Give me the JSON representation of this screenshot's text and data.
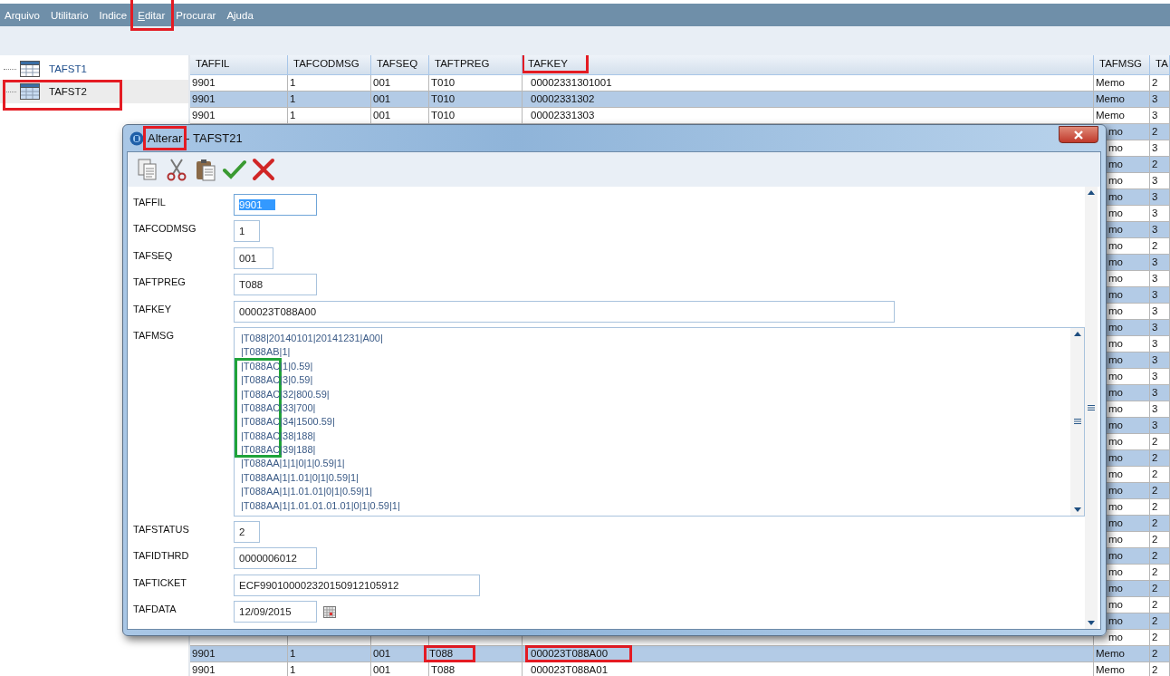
{
  "menu": [
    {
      "label": "Arquivo",
      "highlighted": false
    },
    {
      "label": "Utilitario",
      "highlighted": false
    },
    {
      "label": "Indice",
      "highlighted": false
    },
    {
      "label": "Editar",
      "highlighted": true
    },
    {
      "label": "Procurar",
      "highlighted": false
    },
    {
      "label": "Ajuda",
      "highlighted": false
    }
  ],
  "tree": [
    {
      "label": "TAFST1",
      "selected": false,
      "highlighted": false
    },
    {
      "label": "TAFST2",
      "selected": true,
      "highlighted": true
    }
  ],
  "grid": {
    "columns": [
      {
        "label": "TAFFIL",
        "highlighted": false
      },
      {
        "label": "TAFCODMSG",
        "highlighted": false
      },
      {
        "label": "TAFSEQ",
        "highlighted": false
      },
      {
        "label": "TAFTPREG",
        "highlighted": false
      },
      {
        "label": "TAFKEY",
        "highlighted": true
      },
      {
        "label": "TAFMSG",
        "highlighted": false
      },
      {
        "label": "TA",
        "highlighted": false
      }
    ],
    "rows": [
      {
        "cells": [
          "9901",
          "1",
          "001",
          "T010",
          "00002331301001",
          "Memo",
          "2"
        ]
      },
      {
        "cells": [
          "9901",
          "1",
          "001",
          "T010",
          "00002331302",
          "Memo",
          "3"
        ]
      },
      {
        "cells": [
          "9901",
          "1",
          "001",
          "T010",
          "00002331303",
          "Memo",
          "3"
        ]
      },
      {
        "under_dialog": true,
        "cells": [
          "mo",
          "2"
        ]
      },
      {
        "under_dialog": true,
        "cells": [
          "mo",
          "3"
        ]
      },
      {
        "under_dialog": true,
        "cells": [
          "mo",
          "2"
        ]
      },
      {
        "under_dialog": true,
        "cells": [
          "mo",
          "3"
        ]
      },
      {
        "under_dialog": true,
        "cells": [
          "mo",
          "3"
        ]
      },
      {
        "under_dialog": true,
        "cells": [
          "mo",
          "3"
        ]
      },
      {
        "under_dialog": true,
        "cells": [
          "mo",
          "3"
        ]
      },
      {
        "under_dialog": true,
        "cells": [
          "mo",
          "2"
        ]
      },
      {
        "under_dialog": true,
        "cells": [
          "mo",
          "3"
        ]
      },
      {
        "under_dialog": true,
        "cells": [
          "mo",
          "3"
        ]
      },
      {
        "under_dialog": true,
        "cells": [
          "mo",
          "3"
        ]
      },
      {
        "under_dialog": true,
        "cells": [
          "mo",
          "3"
        ]
      },
      {
        "under_dialog": true,
        "cells": [
          "mo",
          "3"
        ]
      },
      {
        "under_dialog": true,
        "cells": [
          "mo",
          "3"
        ]
      },
      {
        "under_dialog": true,
        "cells": [
          "mo",
          "3"
        ]
      },
      {
        "under_dialog": true,
        "cells": [
          "mo",
          "3"
        ]
      },
      {
        "under_dialog": true,
        "cells": [
          "mo",
          "3"
        ]
      },
      {
        "under_dialog": true,
        "cells": [
          "mo",
          "3"
        ]
      },
      {
        "under_dialog": true,
        "cells": [
          "mo",
          "3"
        ]
      },
      {
        "under_dialog": true,
        "cells": [
          "mo",
          "2"
        ]
      },
      {
        "under_dialog": true,
        "cells": [
          "mo",
          "2"
        ]
      },
      {
        "under_dialog": true,
        "cells": [
          "mo",
          "2"
        ]
      },
      {
        "under_dialog": true,
        "cells": [
          "mo",
          "2"
        ]
      },
      {
        "under_dialog": true,
        "cells": [
          "mo",
          "2"
        ]
      },
      {
        "under_dialog": true,
        "cells": [
          "mo",
          "2"
        ]
      },
      {
        "under_dialog": true,
        "cells": [
          "mo",
          "2"
        ]
      },
      {
        "under_dialog": true,
        "cells": [
          "mo",
          "2"
        ]
      },
      {
        "under_dialog": true,
        "cells": [
          "mo",
          "2"
        ]
      },
      {
        "under_dialog": true,
        "cells": [
          "mo",
          "2"
        ]
      },
      {
        "under_dialog": true,
        "cells": [
          "mo",
          "2"
        ]
      },
      {
        "under_dialog": true,
        "cells": [
          "mo",
          "2"
        ]
      },
      {
        "under_dialog": true,
        "cells": [
          "mo",
          "2"
        ]
      },
      {
        "cells": [
          "9901",
          "1",
          "001",
          "T088",
          "000023T088A00",
          "Memo",
          "2"
        ],
        "highlighted": [
          false,
          false,
          false,
          true,
          true,
          false,
          false
        ]
      },
      {
        "cells": [
          "9901",
          "1",
          "001",
          "T088",
          "000023T088A01",
          "Memo",
          "2"
        ]
      }
    ]
  },
  "dialog": {
    "title": [
      {
        "text": "Alterar",
        "highlighted": true
      },
      {
        "text": "- TAFST21",
        "highlighted": false
      }
    ],
    "toolbar": [
      {
        "kind": "copy"
      },
      {
        "kind": "cut"
      },
      {
        "kind": "paste"
      },
      {
        "kind": "confirm"
      },
      {
        "kind": "cancel"
      }
    ],
    "fields": [
      {
        "kind": "text",
        "label": "TAFFIL",
        "value": "9901",
        "value_selected": true
      },
      {
        "kind": "text",
        "label": "TAFCODMSG",
        "value": "1"
      },
      {
        "kind": "text",
        "label": "TAFSEQ",
        "value": "001"
      },
      {
        "kind": "text",
        "label": "TAFTPREG",
        "value": "T088"
      },
      {
        "kind": "text",
        "label": "TAFKEY",
        "value": "000023T088A00"
      },
      {
        "kind": "memo",
        "label": "TAFMSG",
        "lines": [
          "|T088|20140101|20141231|A00|",
          "|T088AB|1|",
          "|T088AC|1|0.59|",
          "|T088AC|3|0.59|",
          "|T088AC|32|800.59|",
          "|T088AC|33|700|",
          "|T088AC|34|1500.59|",
          "|T088AC|38|188|",
          "|T088AC|39|188|",
          "|T088AA|1|1|0|1|0.59|1|",
          "|T088AA|1|1.01|0|1|0.59|1|",
          "|T088AA|1|1.01.01|0|1|0.59|1|",
          "|T088AA|1|1.01.01.01.01|0|1|0.59|1|"
        ]
      },
      {
        "kind": "text",
        "label": "TAFSTATUS",
        "value": "2"
      },
      {
        "kind": "text",
        "label": "TAFIDTHRD",
        "value": "0000006012"
      },
      {
        "kind": "text",
        "label": "TAFTICKET",
        "value": "ECF990100002320150912105912"
      },
      {
        "kind": "date",
        "label": "TAFDATA",
        "value": "12/09/2015"
      }
    ]
  }
}
